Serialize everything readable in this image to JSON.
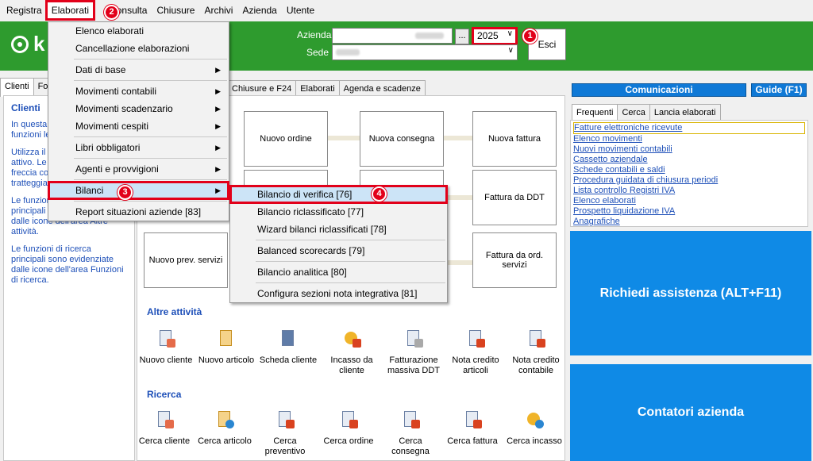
{
  "menubar": [
    "Registra",
    "Elaborati",
    "Consulta",
    "Chiusure",
    "Archivi",
    "Azienda",
    "Utente"
  ],
  "header": {
    "azienda_label": "Azienda",
    "sede_label": "Sede",
    "dots": "...",
    "year": "2025",
    "esci": "Esci",
    "logo_text": "k"
  },
  "badges": [
    "1",
    "2",
    "3",
    "4"
  ],
  "left_tabs": [
    "Clienti",
    "Fo"
  ],
  "mid_tabs": [
    "Chiusure e F24",
    "Elaborati",
    "Agenda e scadenze"
  ],
  "left_panel": {
    "title": "Clienti",
    "p1": "In questa ... le scorciat... funzioni le... clienti.",
    "p2": "Utilizza il ... tra le funz... attivo. Le ... concaten... una freccia continua o tratteggiata.",
    "p3": "Le funzioni accessorie principali sono evidenziate dalle icone dell'area Altre attività.",
    "p4": "Le funzioni di ricerca principali sono evidenziate dalle icone dell'area Funzioni di ricerca."
  },
  "process": [
    "Nuovo ordine",
    "Nuova consegna",
    "Nuova fattura",
    "Fattura da DDT",
    "Nuovo prev. servizi",
    "Fattura da ord. servizi"
  ],
  "altre_title": "Altre attività",
  "altre": [
    "Nuovo cliente",
    "Nuovo articolo",
    "Scheda cliente",
    "Incasso da cliente",
    "Fatturazione massiva DDT",
    "Nota credito articoli",
    "Nota credito contabile"
  ],
  "ricerca_title": "Ricerca",
  "ricerca": [
    "Cerca cliente",
    "Cerca articolo",
    "Cerca preventivo",
    "Cerca ordine",
    "Cerca consegna",
    "Cerca fattura",
    "Cerca incasso"
  ],
  "right": {
    "comunicazioni": "Comunicazioni",
    "guide": "Guide (F1)",
    "tabs": [
      "Frequenti",
      "Cerca",
      "Lancia elaborati"
    ],
    "links": [
      "Fatture elettroniche ricevute",
      "Elenco movimenti",
      "Nuovi movimenti contabili",
      "Cassetto aziendale",
      "Schede contabili e saldi",
      "Procedura guidata di chiusura periodi",
      "Lista controllo Registri IVA",
      "Elenco elaborati",
      "Prospetto liquidazione IVA",
      "Anagrafiche"
    ],
    "assist": "Richiedi assistenza  (ALT+F11)",
    "contatori": "Contatori azienda"
  },
  "menu_elaborati": [
    "Elenco elaborati",
    "Cancellazione elaborazioni",
    "Dati di base",
    "Movimenti contabili",
    "Movimenti scadenzario",
    "Movimenti cespiti",
    "Libri obbligatori",
    "Agenti e provvigioni",
    "Bilanci",
    "Report situazioni aziende [83]"
  ],
  "menu_bilanci": [
    "Bilancio di verifica [76]",
    "Bilancio riclassificato [77]",
    "Wizard bilanci riclassificati [78]",
    "Balanced scorecards [79]",
    "Bilancio analitica [80]",
    "Configura sezioni nota integrativa [81]"
  ],
  "colors": {
    "header_green": "#2e9b2e",
    "highlight_red": "#e2001a",
    "tile_blue": "#0f8ae6",
    "link_blue": "#1d4fb8"
  }
}
